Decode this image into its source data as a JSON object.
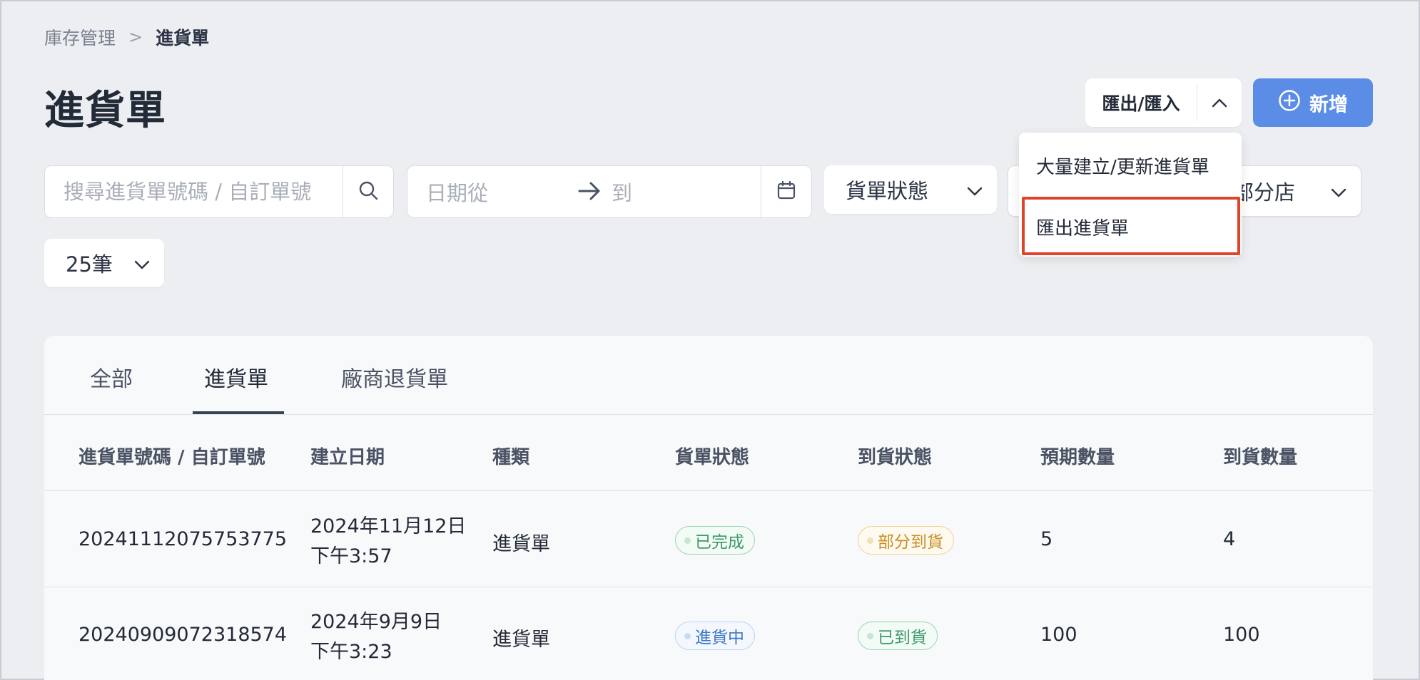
{
  "breadcrumb": {
    "parent": "庫存管理",
    "separator": ">",
    "current": "進貨單"
  },
  "page_title": "進貨單",
  "header": {
    "export_label": "匯出/匯入",
    "add_label": "新增"
  },
  "export_menu": {
    "items": [
      "大量建立/更新進貨單",
      "匯出進貨單"
    ],
    "highlighted_index": 1
  },
  "filters": {
    "search_placeholder": "搜尋進貨單號碼 / 自訂單號",
    "date_from": "日期從",
    "date_to": "到",
    "status_label": "貨單狀態",
    "store_label": "部分店",
    "per_page": "25筆"
  },
  "tabs": [
    {
      "label": "全部"
    },
    {
      "label": "進貨單",
      "active": true
    },
    {
      "label": "廠商退貨單"
    }
  ],
  "table": {
    "columns": [
      "進貨單號碼 / 自訂單號",
      "建立日期",
      "種類",
      "貨單狀態",
      "到貨狀態",
      "預期數量",
      "到貨數量"
    ],
    "rows": [
      {
        "number": "20241112075753775",
        "date_line1": "2024年11月12日",
        "date_line2": "下午3:57",
        "type": "進貨單",
        "order_status": "已完成",
        "arrival_status": "部分到貨",
        "expected_qty": "5",
        "received_qty": "4"
      },
      {
        "number": "20240909072318574",
        "date_line1": "2024年9月9日",
        "date_line2": "下午3:23",
        "type": "進貨單",
        "order_status": "進貨中",
        "arrival_status": "已到貨",
        "expected_qty": "100",
        "received_qty": "100"
      }
    ]
  },
  "colors": {
    "primary": "#5b8de6",
    "highlight_border": "#e0432c",
    "status_green": "#3e9a6a",
    "status_orange": "#c88f22",
    "status_blue": "#3d78c6"
  }
}
